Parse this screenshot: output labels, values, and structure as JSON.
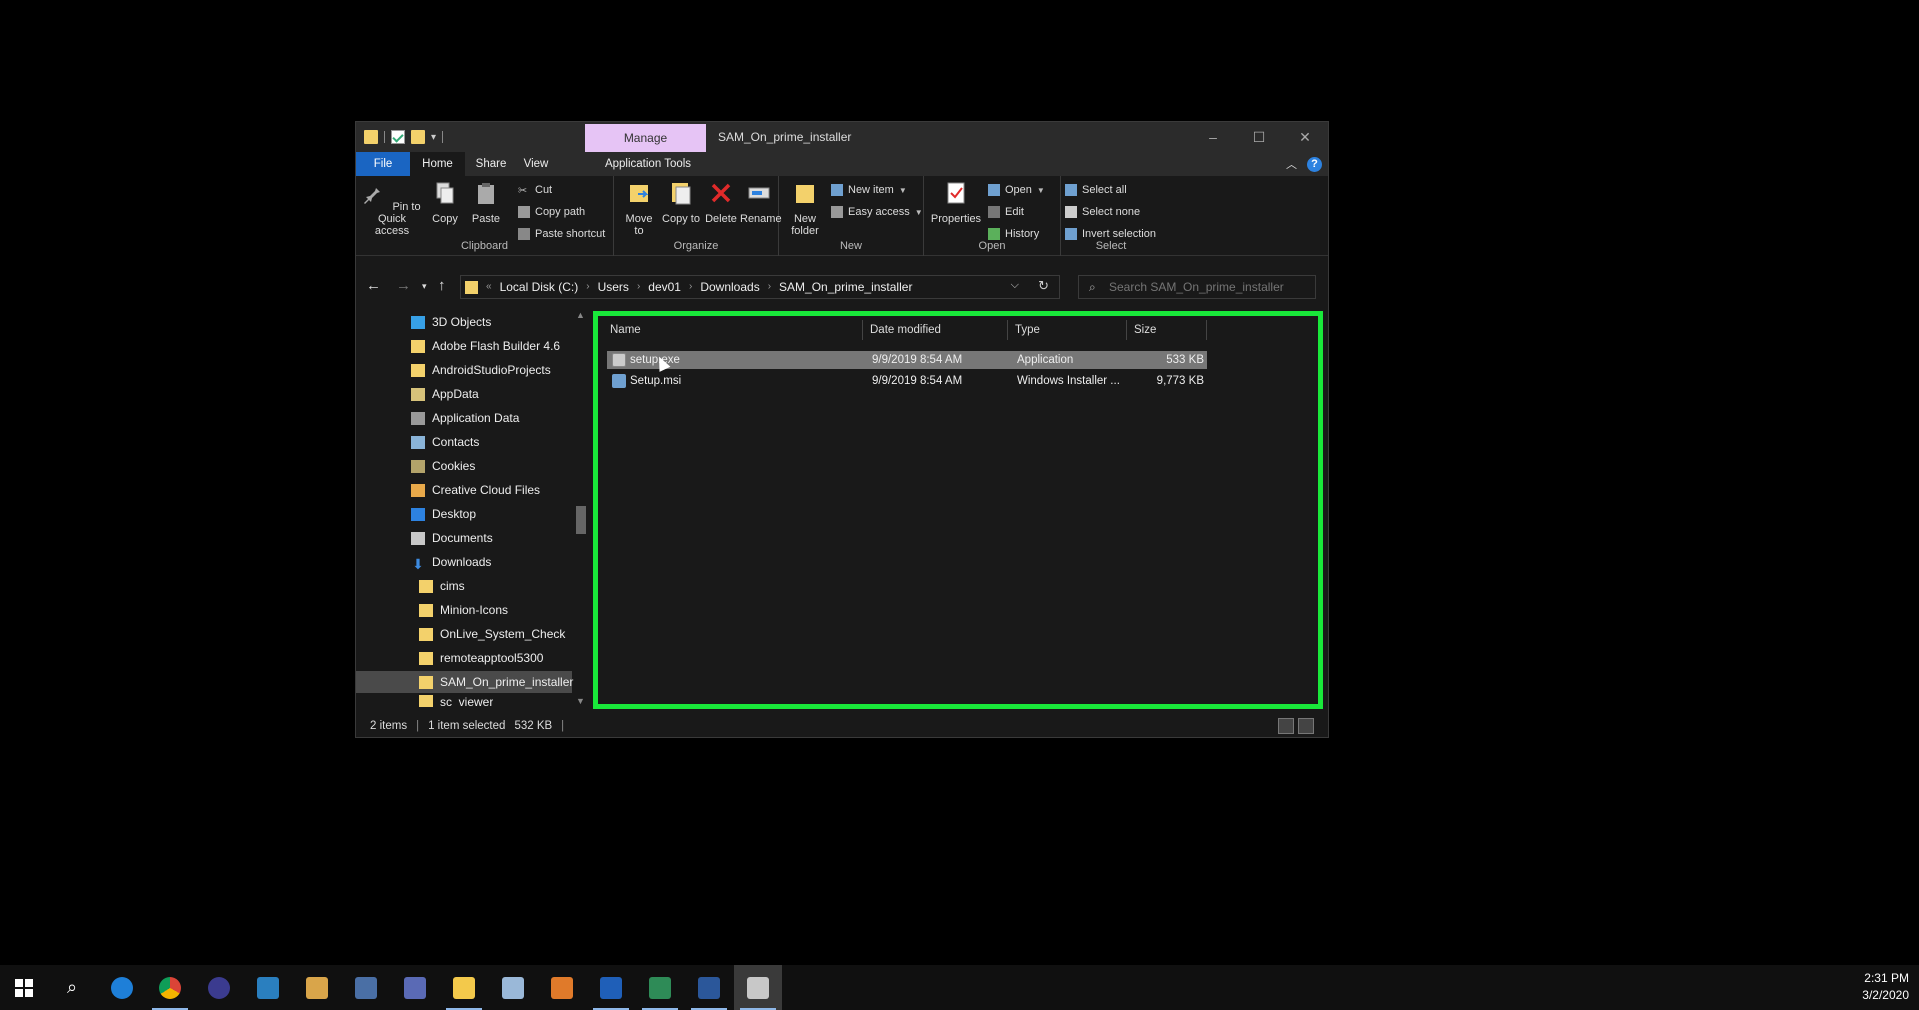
{
  "titlebar": {
    "manage_tab": "Manage",
    "title": "SAM_On_prime_installer",
    "minimize": "–",
    "maximize": "☐",
    "close": "✕"
  },
  "ribbon_tabs": {
    "file": "File",
    "home": "Home",
    "share": "Share",
    "view": "View",
    "app_tools": "Application Tools"
  },
  "ribbon": {
    "clipboard": {
      "label": "Clipboard",
      "pin": "Pin to Quick access",
      "copy": "Copy",
      "paste": "Paste",
      "cut": "Cut",
      "copy_path": "Copy path",
      "paste_shortcut": "Paste shortcut"
    },
    "organize": {
      "label": "Organize",
      "move_to": "Move to",
      "copy_to": "Copy to",
      "delete": "Delete",
      "rename": "Rename"
    },
    "new": {
      "label": "New",
      "new_folder": "New folder",
      "new_item": "New item",
      "easy_access": "Easy access"
    },
    "open": {
      "label": "Open",
      "properties": "Properties",
      "open": "Open",
      "edit": "Edit",
      "history": "History"
    },
    "select": {
      "label": "Select",
      "select_all": "Select all",
      "select_none": "Select none",
      "invert": "Invert selection"
    }
  },
  "address": {
    "crumbs": [
      "Local Disk (C:)",
      "Users",
      "dev01",
      "Downloads",
      "SAM_On_prime_installer"
    ],
    "search_placeholder": "Search SAM_On_prime_installer"
  },
  "nav_pane": {
    "items": [
      {
        "label": "3D Objects",
        "icon": "3d-objects-icon"
      },
      {
        "label": "Adobe Flash Builder 4.6",
        "icon": "folder-icon"
      },
      {
        "label": "AndroidStudioProjects",
        "icon": "folder-icon"
      },
      {
        "label": "AppData",
        "icon": "folder-icon"
      },
      {
        "label": "Application Data",
        "icon": "shortcut-folder-icon"
      },
      {
        "label": "Contacts",
        "icon": "contacts-icon"
      },
      {
        "label": "Cookies",
        "icon": "shortcut-folder-icon"
      },
      {
        "label": "Creative Cloud Files",
        "icon": "folder-icon"
      },
      {
        "label": "Desktop",
        "icon": "desktop-icon"
      },
      {
        "label": "Documents",
        "icon": "documents-icon"
      },
      {
        "label": "Downloads",
        "icon": "downloads-icon"
      },
      {
        "label": "cims",
        "icon": "folder-icon"
      },
      {
        "label": "Minion-Icons",
        "icon": "folder-icon"
      },
      {
        "label": "OnLive_System_Check",
        "icon": "folder-icon"
      },
      {
        "label": "remoteapptool5300",
        "icon": "folder-icon"
      },
      {
        "label": "SAM_On_prime_installer",
        "icon": "folder-icon"
      },
      {
        "label": "sc_viewer",
        "icon": "folder-icon"
      }
    ]
  },
  "file_list": {
    "columns": [
      "Name",
      "Date modified",
      "Type",
      "Size"
    ],
    "rows": [
      {
        "name": "setup.exe",
        "date": "9/9/2019 8:54 AM",
        "type": "Application",
        "size": "533 KB"
      },
      {
        "name": "Setup.msi",
        "date": "9/9/2019 8:54 AM",
        "type": "Windows Installer ...",
        "size": "9,773 KB"
      }
    ]
  },
  "status": {
    "count": "2 items",
    "selected": "1 item selected",
    "size": "532 KB"
  },
  "taskbar": {
    "time": "2:31 PM",
    "date": "3/2/2020"
  },
  "colors": {
    "highlight": "#19e83a",
    "file_tab": "#1a65c2",
    "manage_tab": "#e6c4f5"
  }
}
